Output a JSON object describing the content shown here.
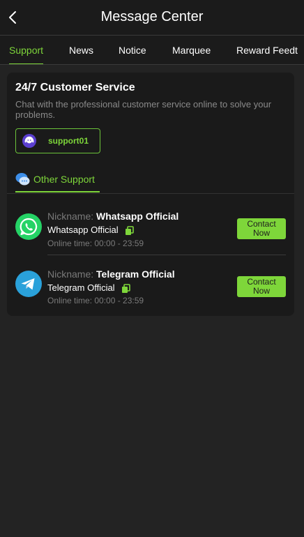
{
  "header": {
    "title": "Message Center",
    "back_icon": "chevron-left-icon"
  },
  "tabs": [
    {
      "label": "Support",
      "active": true
    },
    {
      "label": "News",
      "active": false
    },
    {
      "label": "Notice",
      "active": false
    },
    {
      "label": "Marquee",
      "active": false
    },
    {
      "label": "Reward Feedt",
      "active": false
    }
  ],
  "customer_service": {
    "title": "24/7 Customer Service",
    "description": "Chat with the professional customer service online to solve your problems.",
    "support_agent": {
      "name": "support01",
      "icon": "support-avatar-icon"
    }
  },
  "other_support": {
    "label": "Other Support",
    "icon": "chat-bubbles-icon",
    "contacts": [
      {
        "icon": "whatsapp-icon",
        "nickname_prefix": "Nickname:",
        "nickname": "Whatsapp Official",
        "account": "Whatsapp Official",
        "online_time": "Online time:  00:00 - 23:59",
        "button": "Contact Now"
      },
      {
        "icon": "telegram-icon",
        "nickname_prefix": "Nickname:",
        "nickname": "Telegram Official",
        "account": "Telegram Official",
        "online_time": "Online time:  00:00 - 23:59",
        "button": "Contact Now"
      }
    ]
  },
  "colors": {
    "accent": "#7ed63a",
    "background": "#232323",
    "card": "#1a1a1a",
    "header": "#1b1b1b",
    "muted_text": "#7a7a7a",
    "whatsapp": "#25d366",
    "telegram": "#2aa1da"
  }
}
